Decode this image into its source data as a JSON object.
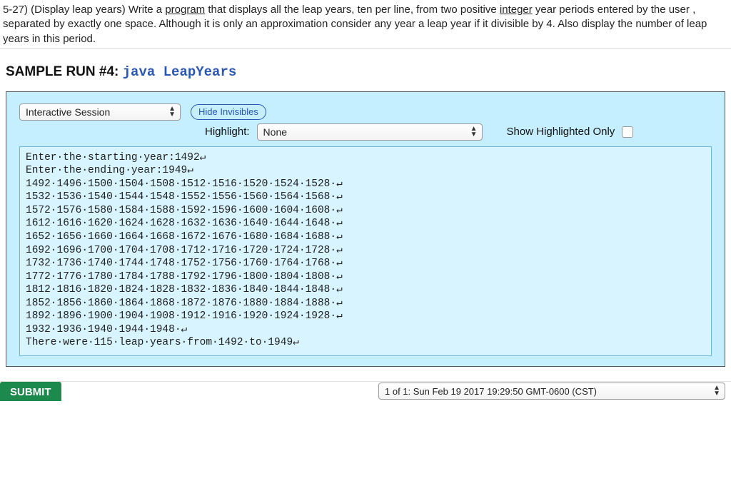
{
  "prompt": {
    "p1a": "5-27) (Display leap years) Write a ",
    "p1_program": "program",
    "p1b": " that displays all the leap years, ten per line, from two positive ",
    "p2_integer": "integer",
    "p2a": " year periods entered by the user , separated by exactly one space. Although it is only an approximation consider any year a leap year if it divisible by 4. Also display the number of leap years in this period."
  },
  "sample": {
    "label": "SAMPLE RUN #4: ",
    "command": "java LeapYears"
  },
  "controls": {
    "session_select": "Interactive Session",
    "hide_btn": "Hide Invisibles",
    "highlight_label": "Highlight:",
    "highlight_value": "None",
    "show_only_label": "Show Highlighted Only"
  },
  "output": {
    "dot": "·",
    "ret": "↵",
    "lines": [
      "Enter·the·starting·year:1492↵",
      "Enter·the·ending·year:1949↵",
      "1492·1496·1500·1504·1508·1512·1516·1520·1524·1528·↵",
      "1532·1536·1540·1544·1548·1552·1556·1560·1564·1568·↵",
      "1572·1576·1580·1584·1588·1592·1596·1600·1604·1608·↵",
      "1612·1616·1620·1624·1628·1632·1636·1640·1644·1648·↵",
      "1652·1656·1660·1664·1668·1672·1676·1680·1684·1688·↵",
      "1692·1696·1700·1704·1708·1712·1716·1720·1724·1728·↵",
      "1732·1736·1740·1744·1748·1752·1756·1760·1764·1768·↵",
      "1772·1776·1780·1784·1788·1792·1796·1800·1804·1808·↵",
      "1812·1816·1820·1824·1828·1832·1836·1840·1844·1848·↵",
      "1852·1856·1860·1864·1868·1872·1876·1880·1884·1888·↵",
      "1892·1896·1900·1904·1908·1912·1916·1920·1924·1928·↵",
      "1932·1936·1940·1944·1948·↵",
      "There·were·115·leap·years·from·1492·to·1949↵"
    ]
  },
  "footer": {
    "submit": "SUBMIT",
    "history": "1 of 1: Sun Feb 19 2017 19:29:50 GMT-0600 (CST)"
  }
}
